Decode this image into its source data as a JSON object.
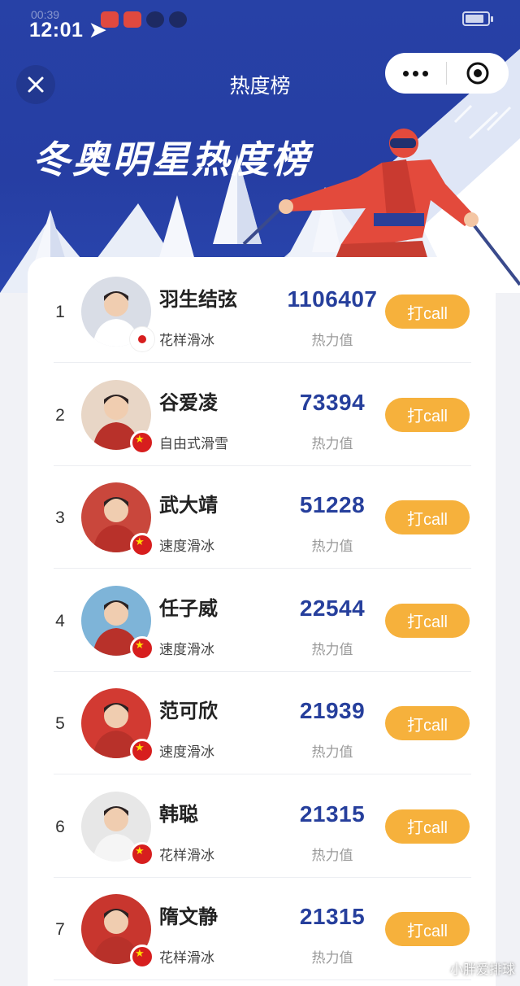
{
  "status_bar": {
    "time": "12:01",
    "ghost_time": "00:39",
    "battery_level": 0.85
  },
  "nav": {
    "title": "热度榜"
  },
  "banner": {
    "headline": "冬奥明星热度榜"
  },
  "colors": {
    "banner_blue": "#2741a6",
    "score_blue": "#263f9c",
    "call_orange": "#f6b13c",
    "flag_red": "#d71e1e"
  },
  "ranking": [
    {
      "rank": "1",
      "name": "羽生结弦",
      "sport": "花样滑冰",
      "score": "1106407",
      "score_label": "热力值",
      "button": "打call",
      "flag": "japan-flag-icon",
      "avatar_color": "#d9dde6"
    },
    {
      "rank": "2",
      "name": "谷爱凌",
      "sport": "自由式滑雪",
      "score": "73394",
      "score_label": "热力值",
      "button": "打call",
      "flag": "china-flag-icon",
      "avatar_color": "#e8d6c6"
    },
    {
      "rank": "3",
      "name": "武大靖",
      "sport": "速度滑冰",
      "score": "51228",
      "score_label": "热力值",
      "button": "打call",
      "flag": "china-flag-icon",
      "avatar_color": "#c9473c"
    },
    {
      "rank": "4",
      "name": "任子威",
      "sport": "速度滑冰",
      "score": "22544",
      "score_label": "热力值",
      "button": "打call",
      "flag": "china-flag-icon",
      "avatar_color": "#7eb4d8"
    },
    {
      "rank": "5",
      "name": "范可欣",
      "sport": "速度滑冰",
      "score": "21939",
      "score_label": "热力值",
      "button": "打call",
      "flag": "china-flag-icon",
      "avatar_color": "#d23a32"
    },
    {
      "rank": "6",
      "name": "韩聪",
      "sport": "花样滑冰",
      "score": "21315",
      "score_label": "热力值",
      "button": "打call",
      "flag": "china-flag-icon",
      "avatar_color": "#e7e7e7"
    },
    {
      "rank": "7",
      "name": "隋文静",
      "sport": "花样滑冰",
      "score": "21315",
      "score_label": "热力值",
      "button": "打call",
      "flag": "china-flag-icon",
      "avatar_color": "#c8362e"
    }
  ],
  "watermark": "小胖爱排球"
}
